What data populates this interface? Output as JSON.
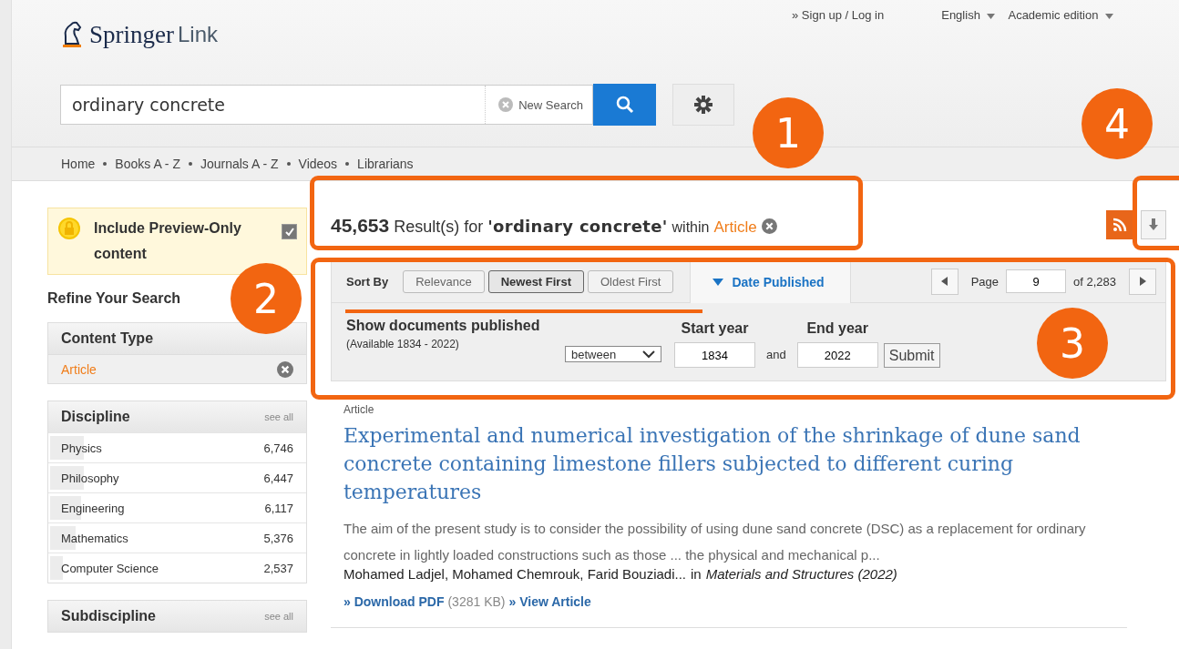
{
  "header": {
    "logo_main": "Springer",
    "logo_sub": "Link",
    "signup": "» Sign up / Log in",
    "language": "English",
    "edition": "Academic edition"
  },
  "search": {
    "value": "ordinary concrete",
    "new_search": "New Search"
  },
  "nav": [
    "Home",
    "Books A - Z",
    "Journals A - Z",
    "Videos",
    "Librarians"
  ],
  "preview": {
    "label": "Include Preview-Only content",
    "checked": true
  },
  "refine_title": "Refine Your Search",
  "content_type": {
    "title": "Content Type",
    "value": "Article"
  },
  "discipline": {
    "title": "Discipline",
    "see_all": "see all",
    "items": [
      {
        "name": "Physics",
        "count": "6,746",
        "level": 0.13
      },
      {
        "name": "Philosophy",
        "count": "6,447",
        "level": 0.13
      },
      {
        "name": "Engineering",
        "count": "6,117",
        "level": 0.12
      },
      {
        "name": "Mathematics",
        "count": "5,376",
        "level": 0.1
      },
      {
        "name": "Computer Science",
        "count": "2,537",
        "level": 0.05
      }
    ]
  },
  "subdiscipline": {
    "title": "Subdiscipline",
    "see_all": "see all"
  },
  "results": {
    "count": "45,653",
    "text": "Result(s) for",
    "query": "'ordinary concrete'",
    "within": "within",
    "type": "Article"
  },
  "sort": {
    "label": "Sort By",
    "options": [
      {
        "label": "Relevance",
        "selected": false
      },
      {
        "label": "Newest First",
        "selected": true
      },
      {
        "label": "Oldest First",
        "selected": false
      }
    ],
    "date_tab": "Date Published",
    "page_label": "Page",
    "page": "9",
    "of": "of 2,283"
  },
  "date_filter": {
    "title": "Show documents published",
    "available": "(Available 1834 - 2022)",
    "mode": "between",
    "start_label": "Start year",
    "start": "1834",
    "and": "and",
    "end_label": "End year",
    "end": "2022",
    "submit": "Submit"
  },
  "article": {
    "type": "Article",
    "title": "Experimental and numerical investigation of the shrinkage of dune sand concrete containing limestone fillers subjected to different curing temperatures",
    "abstract": "The aim of the present study is to consider the possibility of using dune sand concrete (DSC) as a replacement for ordinary concrete in lightly loaded constructions such as those ... the physical and mechanical p...",
    "authors": "Mohamed Ladjel, Mohamed Chemrouk, Farid Bouziadi...",
    "in": "in",
    "journal": "Materials and Structures (2022)",
    "download": "» Download PDF",
    "size": "(3281 KB)",
    "view": "» View Article"
  },
  "annotations": [
    {
      "label": "1"
    },
    {
      "label": "2"
    },
    {
      "label": "3"
    },
    {
      "label": "4"
    }
  ]
}
